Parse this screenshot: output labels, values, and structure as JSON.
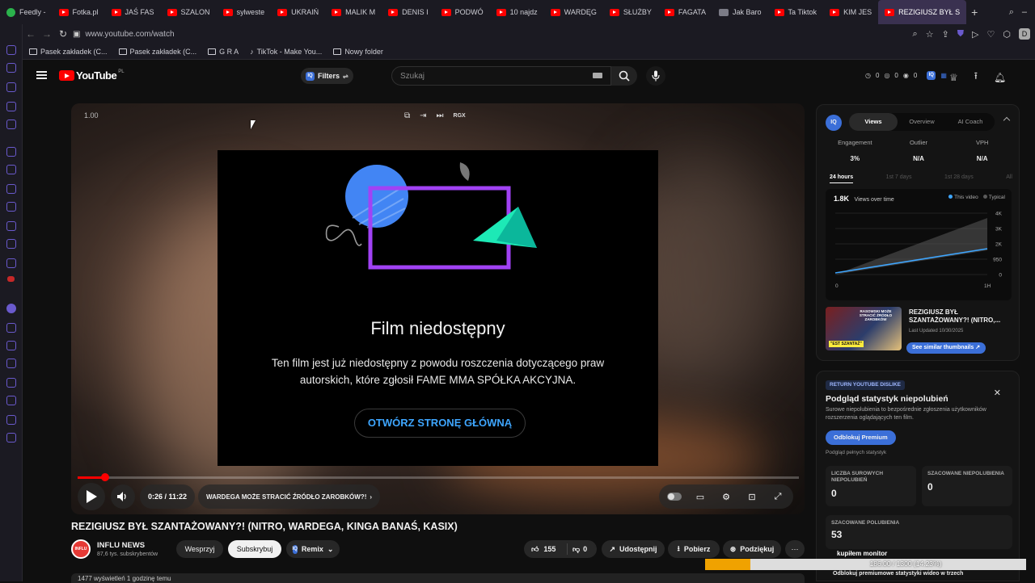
{
  "browser": {
    "tabs": [
      {
        "label": "Feedly -",
        "icon": "feedly-icon"
      },
      {
        "label": "Fotka.pl",
        "icon": "youtube-icon"
      },
      {
        "label": "JAŚ FAS",
        "icon": "youtube-icon"
      },
      {
        "label": "SZALON",
        "icon": "youtube-icon"
      },
      {
        "label": "sylweste",
        "icon": "youtube-icon"
      },
      {
        "label": "UKRAIŃ",
        "icon": "youtube-icon"
      },
      {
        "label": "MALIK M",
        "icon": "youtube-icon"
      },
      {
        "label": "DENIS I",
        "icon": "youtube-icon"
      },
      {
        "label": "PODWÓ",
        "icon": "youtube-icon"
      },
      {
        "label": "10 najdz",
        "icon": "youtube-icon"
      },
      {
        "label": "WARDĘG",
        "icon": "youtube-icon"
      },
      {
        "label": "SŁUŻBY",
        "icon": "youtube-icon"
      },
      {
        "label": "FAGATA",
        "icon": "youtube-icon"
      },
      {
        "label": "Jak Baro",
        "icon": "generic-page-icon"
      },
      {
        "label": "Ta Tiktok",
        "icon": "youtube-icon"
      },
      {
        "label": "KIM JES",
        "icon": "youtube-icon"
      },
      {
        "label": "REZIGIUSZ BYŁ S",
        "icon": "youtube-icon",
        "active": true
      }
    ],
    "new_tab": "+",
    "url": "www.youtube.com/watch",
    "profile_initial": "D",
    "bookmarks": [
      {
        "label": "Pasek zakładek (C...",
        "type": "folder"
      },
      {
        "label": "Pasek zakładek (C...",
        "type": "folder"
      },
      {
        "label": "G R A",
        "type": "folder"
      },
      {
        "label": "TikTok - Make You...",
        "type": "tiktok"
      },
      {
        "label": "Nowy folder",
        "type": "folder"
      }
    ]
  },
  "youtube": {
    "logo_text": "YouTube",
    "region": "PL",
    "filters_label": "Filters",
    "search_placeholder": "Szukaj",
    "counters": [
      "0",
      "0",
      "0"
    ]
  },
  "player": {
    "speed": "1.00",
    "tool_label": "RGX",
    "unavailable_title": "Film niedostępny",
    "unavailable_text": "Ten film jest już niedostępny z powodu roszczenia dotyczącego praw autorskich, które zgłosił FAME MMA SPÓŁKA AKCYJNA.",
    "home_button": "OTWÓRZ STRONĘ GŁÓWNĄ",
    "time": "0:26 / 11:22",
    "progress_fraction": 0.038,
    "chapter": "WARDEGA MOŻE STRACIĆ ŹRÓDŁO ZAROBKÓW?!"
  },
  "video": {
    "title": "REZIGIUSZ BYŁ SZANTAŻOWANY?! (NITRO, WARDEGA, KINGA BANAŚ, KASIX)",
    "channel_name": "INFLU NEWS",
    "channel_subs": "87,6 tys. subskrybentów",
    "avatar_text": "INFLU",
    "support": "Wesprzyj",
    "subscribe": "Subskrybuj",
    "remix": "Remix",
    "likes": "155",
    "dislikes": "0",
    "share": "Udostępnij",
    "download": "Pobierz",
    "thanks": "Podziękuj",
    "description_stub": "1477 wyświetleń  1 godzinę temu"
  },
  "vidiq": {
    "badge": "IQ",
    "tabs": [
      "Views",
      "Overview",
      "AI Coach"
    ],
    "active_tab": "Views",
    "metrics": [
      {
        "label": "Engagement",
        "value": "3%"
      },
      {
        "label": "Outlier",
        "value": "N/A"
      },
      {
        "label": "VPH",
        "value": "N/A"
      }
    ],
    "ranges": [
      "24 hours",
      "1st 7 days",
      "1st 28 days",
      "All"
    ],
    "active_range": "24 hours",
    "views_total": "1.8K",
    "views_label": "Views over time",
    "legend_this": "This video",
    "legend_typical": "Typical",
    "chart_colors": {
      "this": "#3ea6ff",
      "typical": "#5a5a5a"
    },
    "y_ticks": [
      "4K",
      "3K",
      "2K",
      "950",
      "0"
    ],
    "x_ticks": [
      "0",
      "1H"
    ],
    "thumb_title": "REZIGIUSZ BYŁ SZANTAŻOWANY?! (NITRO,...",
    "thumb_updated": "Last Updated 10/30/2025",
    "thumb_caption": "\"EST SZANTAŻ\"",
    "thumb_caption_top": "RASOWSKI MOŻE STRACIĆ ŹRÓDŁO ZAROBKÓW",
    "similar_button": "See similar thumbnails ↗"
  },
  "dislikes_panel": {
    "badge": "RETURN YOUTUBE DISLIKE",
    "title": "Podgląd statystyk niepolubień",
    "description": "Surowe niepolubienia to bezpośrednie zgłoszenia użytkowników rozszerzenia oglądających ten film.",
    "unlock": "Odblokuj Premium",
    "full_stats": "Podgląd pełnych statystyk",
    "raw_label": "LICZBA SUROWYCH NIEPOLUBIEŃ",
    "raw_value": "0",
    "est_label": "SZACOWANE NIEPOLUBIENIA",
    "est_value": "0",
    "likes_label": "SZACOWANE POLUBIENIA",
    "likes_value": "53",
    "bottom_text": "Odblokuj premiumowe statystyki wideo w trzech"
  },
  "monitor": {
    "label": "kupiłem monitor",
    "text": "186.00 / 1300 (14.23%)",
    "fraction": 0.1423,
    "color": "#f0a200"
  }
}
